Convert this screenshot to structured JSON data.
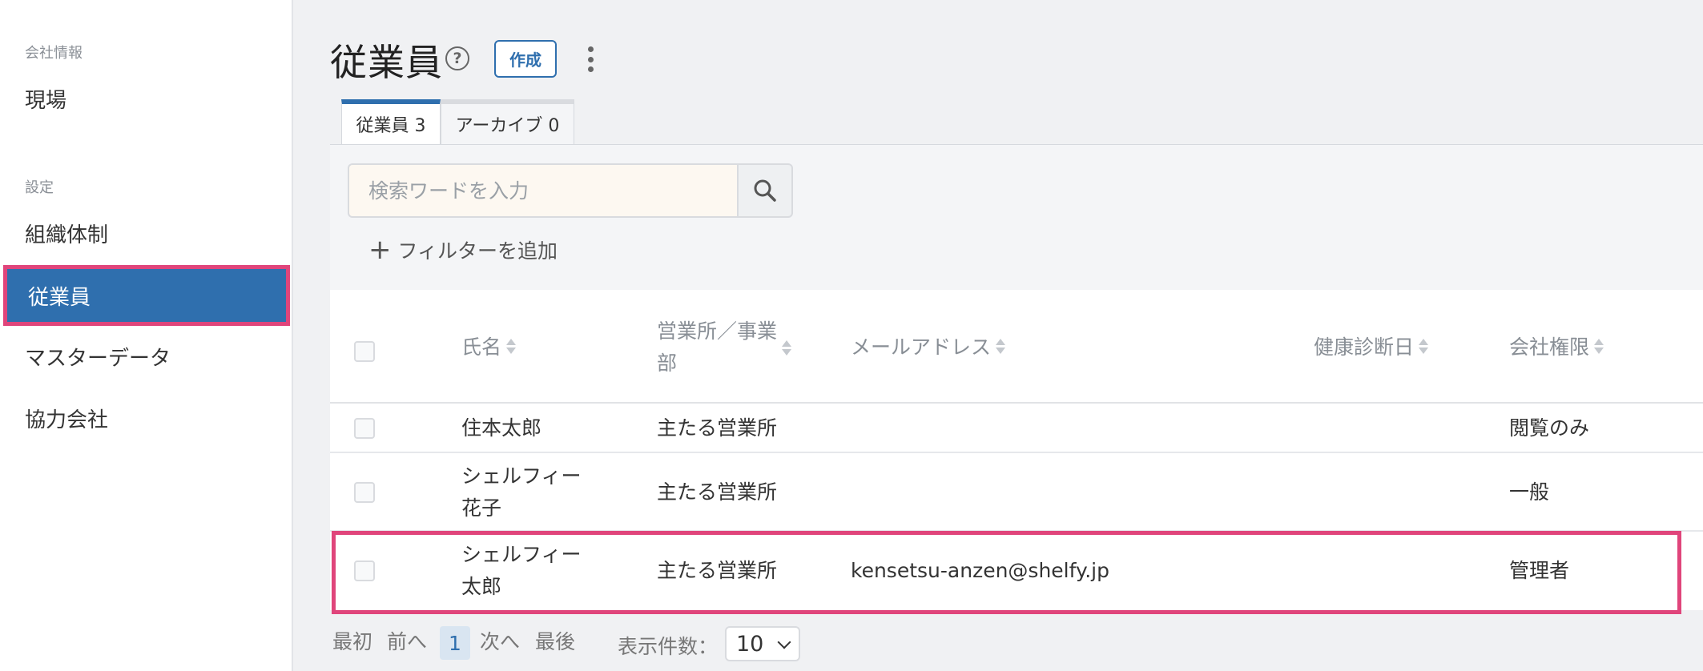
{
  "sidebar": {
    "section_company": "会社情報",
    "item_site": "現場",
    "section_settings": "設定",
    "item_org": "組織体制",
    "item_employees": "従業員",
    "item_master": "マスターデータ",
    "item_partners": "協力会社"
  },
  "header": {
    "title": "従業員",
    "help_glyph": "?",
    "create_label": "作成"
  },
  "tabs": [
    {
      "label": "従業員 3",
      "active": true
    },
    {
      "label": "アーカイブ 0",
      "active": false
    }
  ],
  "search": {
    "placeholder": "検索ワードを入力",
    "add_filter_label": "フィルターを追加"
  },
  "table": {
    "columns": [
      "氏名",
      "営業所／事業部",
      "メールアドレス",
      "健康診断日",
      "会社権限"
    ],
    "rows": [
      {
        "name": "住本太郎",
        "office": "主たる営業所",
        "email": "",
        "health_check": "",
        "role": "閲覧のみ"
      },
      {
        "name": "シェルフィー花子",
        "office": "主たる営業所",
        "email": "",
        "health_check": "",
        "role": "一般"
      },
      {
        "name": "シェルフィー太郎",
        "office": "主たる営業所",
        "email": "kensetsu-anzen@shelfy.jp",
        "health_check": "",
        "role": "管理者"
      }
    ],
    "name_lines": [
      [
        "住本太郎"
      ],
      [
        "シェルフィー",
        "花子"
      ],
      [
        "シェルフィー",
        "太郎"
      ]
    ],
    "office_header_lines": [
      "営業所／事業",
      "部"
    ]
  },
  "pagination": {
    "first": "最初",
    "prev": "前へ",
    "current": "1",
    "next": "次へ",
    "last": "最後",
    "per_page_label": "表示件数：",
    "per_page_value": "10"
  },
  "colors": {
    "primary": "#2f6fae",
    "highlight": "#e0457b"
  }
}
